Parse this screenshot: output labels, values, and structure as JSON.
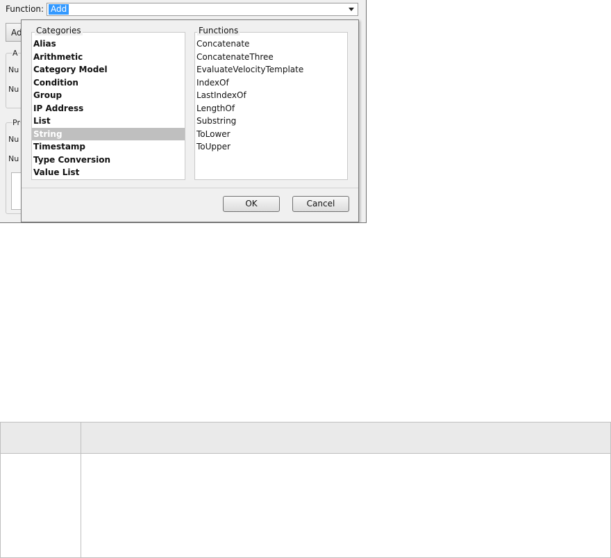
{
  "function_row": {
    "label": "Function:",
    "selected_value": "Add"
  },
  "background": {
    "button_label": "Ad",
    "group1_label": "A",
    "row1": "Nu",
    "row2": "Nu",
    "group2_label": "Pr",
    "row3": "Nu",
    "row4": "Nu"
  },
  "dialog": {
    "categories_title": "Categories",
    "functions_title": "Functions",
    "categories": [
      "Alias",
      "Arithmetic",
      "Category Model",
      "Condition",
      "Group",
      "IP Address",
      "List",
      "String",
      "Timestamp",
      "Type Conversion",
      "Value List"
    ],
    "selected_category": "String",
    "functions": [
      "Concatenate",
      "ConcatenateThree",
      "EvaluateVelocityTemplate",
      "IndexOf",
      "LastIndexOf",
      "LengthOf",
      "Substring",
      "ToLower",
      "ToUpper"
    ],
    "ok_label": "OK",
    "cancel_label": "Cancel"
  },
  "colors": {
    "selection_blue": "#3399ff",
    "selected_category_bg": "#bfbfbf",
    "table_header_bg": "#eaeaea"
  }
}
